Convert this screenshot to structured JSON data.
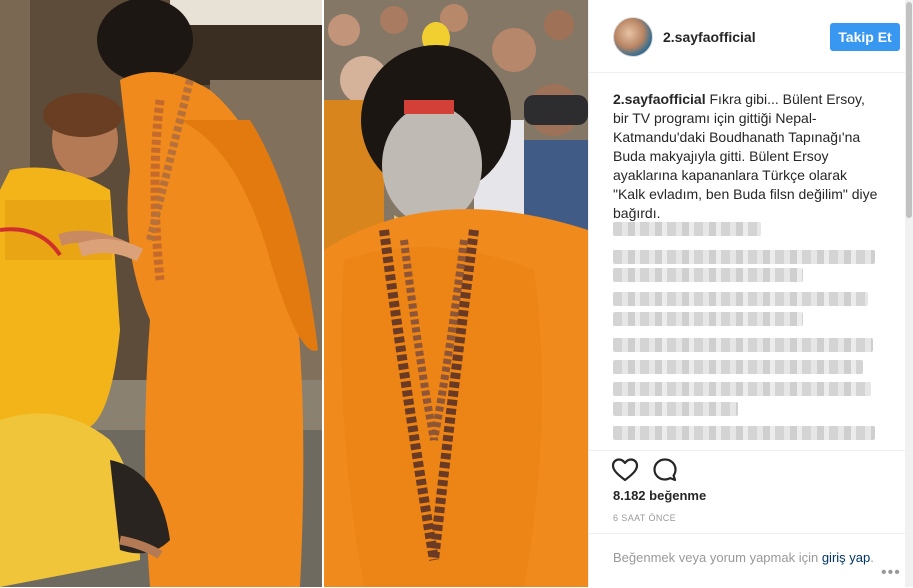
{
  "account": {
    "username": "2.sayfaofficial",
    "follow_label": "Takip Et"
  },
  "caption": {
    "author": "2.sayfaofficial",
    "text": "Fıkra gibi... Bülent Ersoy, bir TV programı için gittiği Nepal-Katmandu'daki Boudhanath Tapınağı'na Buda makyajıyla gitti. Bülent Ersoy ayaklarına kapananlara Türkçe olarak \"Kalk evladım, ben Buda filsn değilim\" diye bağırdı."
  },
  "stats": {
    "likes": "8.182 beğenme",
    "time": "6 SAAT ÖNCE"
  },
  "login_prompt": {
    "text": "Beğenmek veya yorum yapmak için",
    "link": "giriş yap",
    "after": "."
  },
  "icons": {
    "like": "heart-icon",
    "comment": "comment-icon",
    "more": "more-options-icon"
  },
  "colors": {
    "accent": "#3897f0",
    "link": "#003569",
    "muted": "#999999",
    "robe": "#f08a1c"
  }
}
